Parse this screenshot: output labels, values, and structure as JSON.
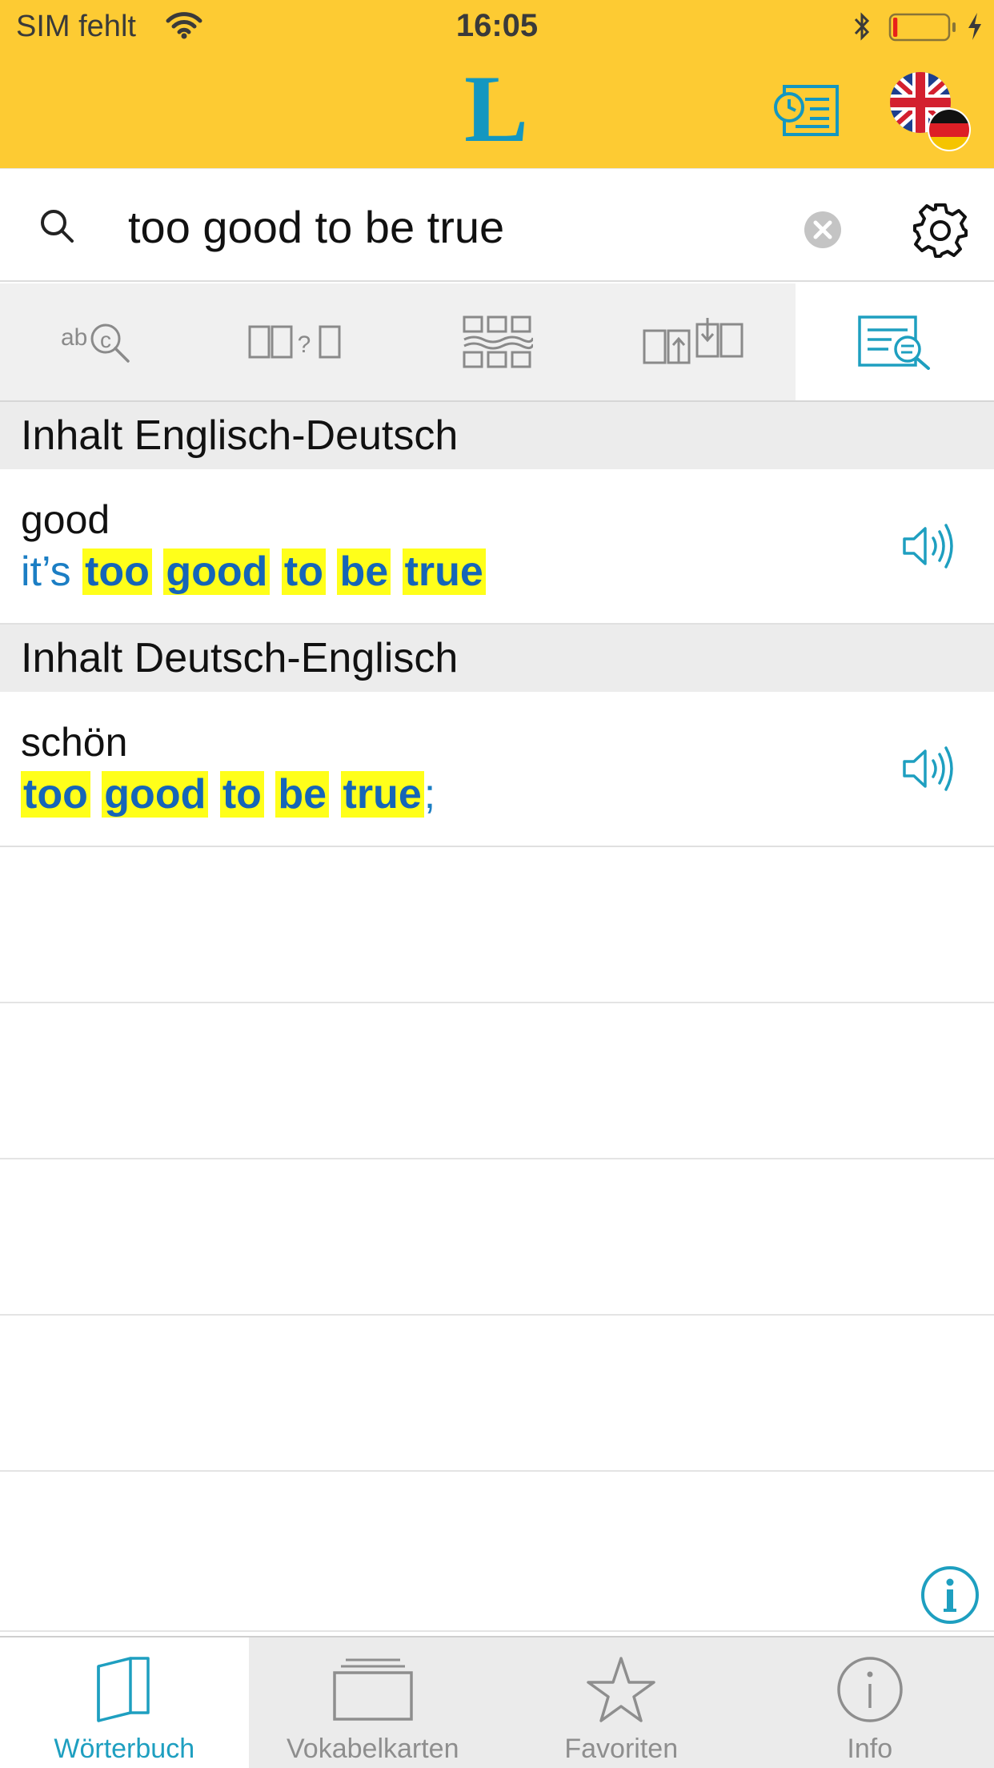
{
  "status_bar": {
    "carrier": "SIM fehlt",
    "time": "16:05",
    "battery_level": 0.08
  },
  "header": {
    "logo_text": "L",
    "history_icon": "history-list-icon",
    "language_icon": "flag-en-de-icon"
  },
  "search": {
    "value": "too good to be true",
    "placeholder": "",
    "clear_icon": "clear-icon",
    "settings_icon": "gear-icon"
  },
  "mode_tabs": [
    {
      "icon": "spell-search-icon",
      "active": false
    },
    {
      "icon": "wildcard-search-icon",
      "active": false
    },
    {
      "icon": "translation-grid-icon",
      "active": false
    },
    {
      "icon": "import-export-icon",
      "active": false
    },
    {
      "icon": "fulltext-search-icon",
      "active": true
    }
  ],
  "sections": [
    {
      "title": "Inhalt Englisch-Deutsch",
      "results": [
        {
          "headword": "good",
          "phrase_prefix": "it’s",
          "phrase_words": [
            "too",
            "good",
            "to",
            "be",
            "true"
          ],
          "phrase_suffix": ""
        }
      ]
    },
    {
      "title": "Inhalt Deutsch-Englisch",
      "results": [
        {
          "headword": "schön",
          "phrase_prefix": "",
          "phrase_words": [
            "too",
            "good",
            "to",
            "be",
            "true"
          ],
          "phrase_suffix": ";"
        }
      ]
    }
  ],
  "tab_bar": {
    "items": [
      {
        "label": "Wörterbuch",
        "icon": "book-icon",
        "active": true
      },
      {
        "label": "Vokabelkarten",
        "icon": "flashcards-icon",
        "active": false
      },
      {
        "label": "Favoriten",
        "icon": "star-icon",
        "active": false
      },
      {
        "label": "Info",
        "icon": "info-icon",
        "active": false
      }
    ]
  },
  "colors": {
    "header_yellow": "#fdcb33",
    "accent_blue": "#1e9fc0",
    "phrase_blue": "#1b7ec4",
    "highlight_yellow": "#ffff1a"
  }
}
